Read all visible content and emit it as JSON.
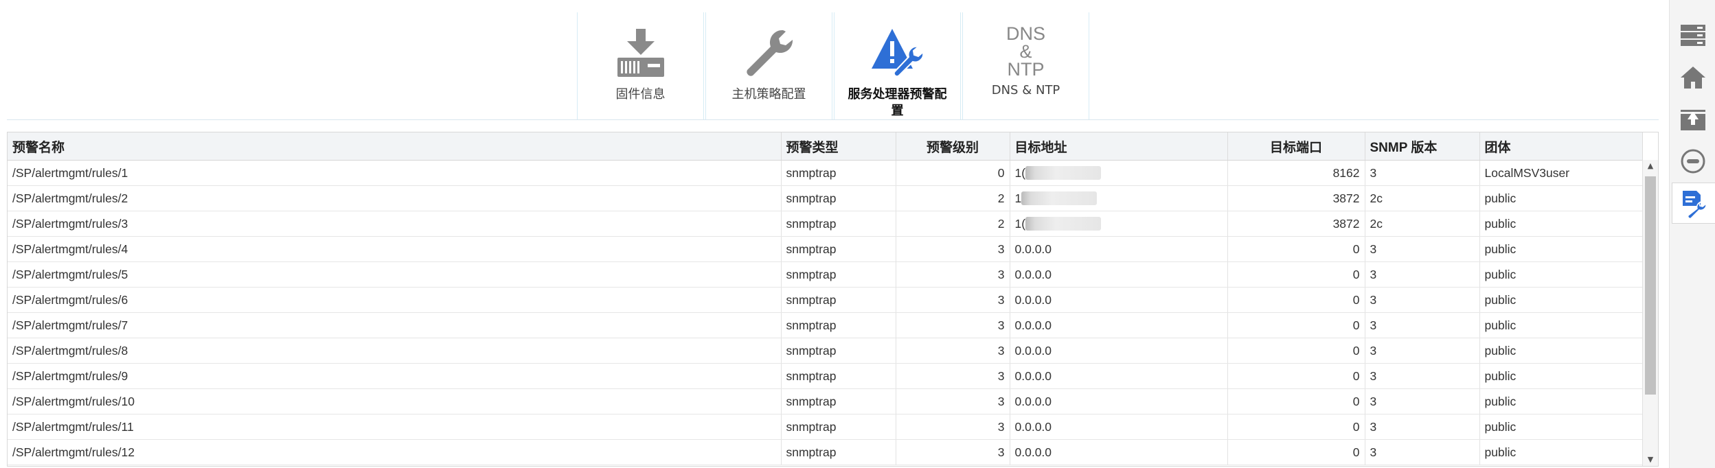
{
  "toolbar": [
    {
      "label": "固件信息",
      "icon": "firmware-download-icon",
      "active": false
    },
    {
      "label": "主机策略配置",
      "icon": "wrench-icon",
      "active": false
    },
    {
      "label": "服务处理器预警配置",
      "icon": "alert-wrench-icon",
      "active": true
    },
    {
      "label": "DNS & NTP",
      "icon": "dns-ntp-icon",
      "active": false,
      "icon_text": [
        "DNS",
        "&",
        "NTP"
      ]
    }
  ],
  "table": {
    "columns": [
      "预警名称",
      "预警类型",
      "预警级别",
      "目标地址",
      "目标端口",
      "SNMP 版本",
      "团体"
    ],
    "rows": [
      {
        "name": "/SP/alertmgmt/rules/1",
        "type": "snmptrap",
        "level": "0",
        "address": "1(",
        "port": "8162",
        "version": "3",
        "community": "LocalMSV3user"
      },
      {
        "name": "/SP/alertmgmt/rules/2",
        "type": "snmptrap",
        "level": "2",
        "address": "1",
        "port": "3872",
        "version": "2c",
        "community": "public"
      },
      {
        "name": "/SP/alertmgmt/rules/3",
        "type": "snmptrap",
        "level": "2",
        "address": "1(",
        "port": "3872",
        "version": "2c",
        "community": "public"
      },
      {
        "name": "/SP/alertmgmt/rules/4",
        "type": "snmptrap",
        "level": "3",
        "address": "0.0.0.0",
        "port": "0",
        "version": "3",
        "community": "public"
      },
      {
        "name": "/SP/alertmgmt/rules/5",
        "type": "snmptrap",
        "level": "3",
        "address": "0.0.0.0",
        "port": "0",
        "version": "3",
        "community": "public"
      },
      {
        "name": "/SP/alertmgmt/rules/6",
        "type": "snmptrap",
        "level": "3",
        "address": "0.0.0.0",
        "port": "0",
        "version": "3",
        "community": "public"
      },
      {
        "name": "/SP/alertmgmt/rules/7",
        "type": "snmptrap",
        "level": "3",
        "address": "0.0.0.0",
        "port": "0",
        "version": "3",
        "community": "public"
      },
      {
        "name": "/SP/alertmgmt/rules/8",
        "type": "snmptrap",
        "level": "3",
        "address": "0.0.0.0",
        "port": "0",
        "version": "3",
        "community": "public"
      },
      {
        "name": "/SP/alertmgmt/rules/9",
        "type": "snmptrap",
        "level": "3",
        "address": "0.0.0.0",
        "port": "0",
        "version": "3",
        "community": "public"
      },
      {
        "name": "/SP/alertmgmt/rules/10",
        "type": "snmptrap",
        "level": "3",
        "address": "0.0.0.0",
        "port": "0",
        "version": "3",
        "community": "public"
      },
      {
        "name": "/SP/alertmgmt/rules/11",
        "type": "snmptrap",
        "level": "3",
        "address": "0.0.0.0",
        "port": "0",
        "version": "3",
        "community": "public"
      },
      {
        "name": "/SP/alertmgmt/rules/12",
        "type": "snmptrap",
        "level": "3",
        "address": "0.0.0.0",
        "port": "0",
        "version": "3",
        "community": "public"
      }
    ]
  },
  "sidebar": [
    {
      "icon": "server-list-icon",
      "active": false
    },
    {
      "icon": "home-icon",
      "active": false
    },
    {
      "icon": "upload-box-icon",
      "active": false
    },
    {
      "icon": "power-circle-icon",
      "active": false
    },
    {
      "icon": "config-wrench-icon",
      "active": true
    }
  ],
  "colors": {
    "accent_blue": "#2e6fd6",
    "icon_gray": "#8a8a8a"
  }
}
